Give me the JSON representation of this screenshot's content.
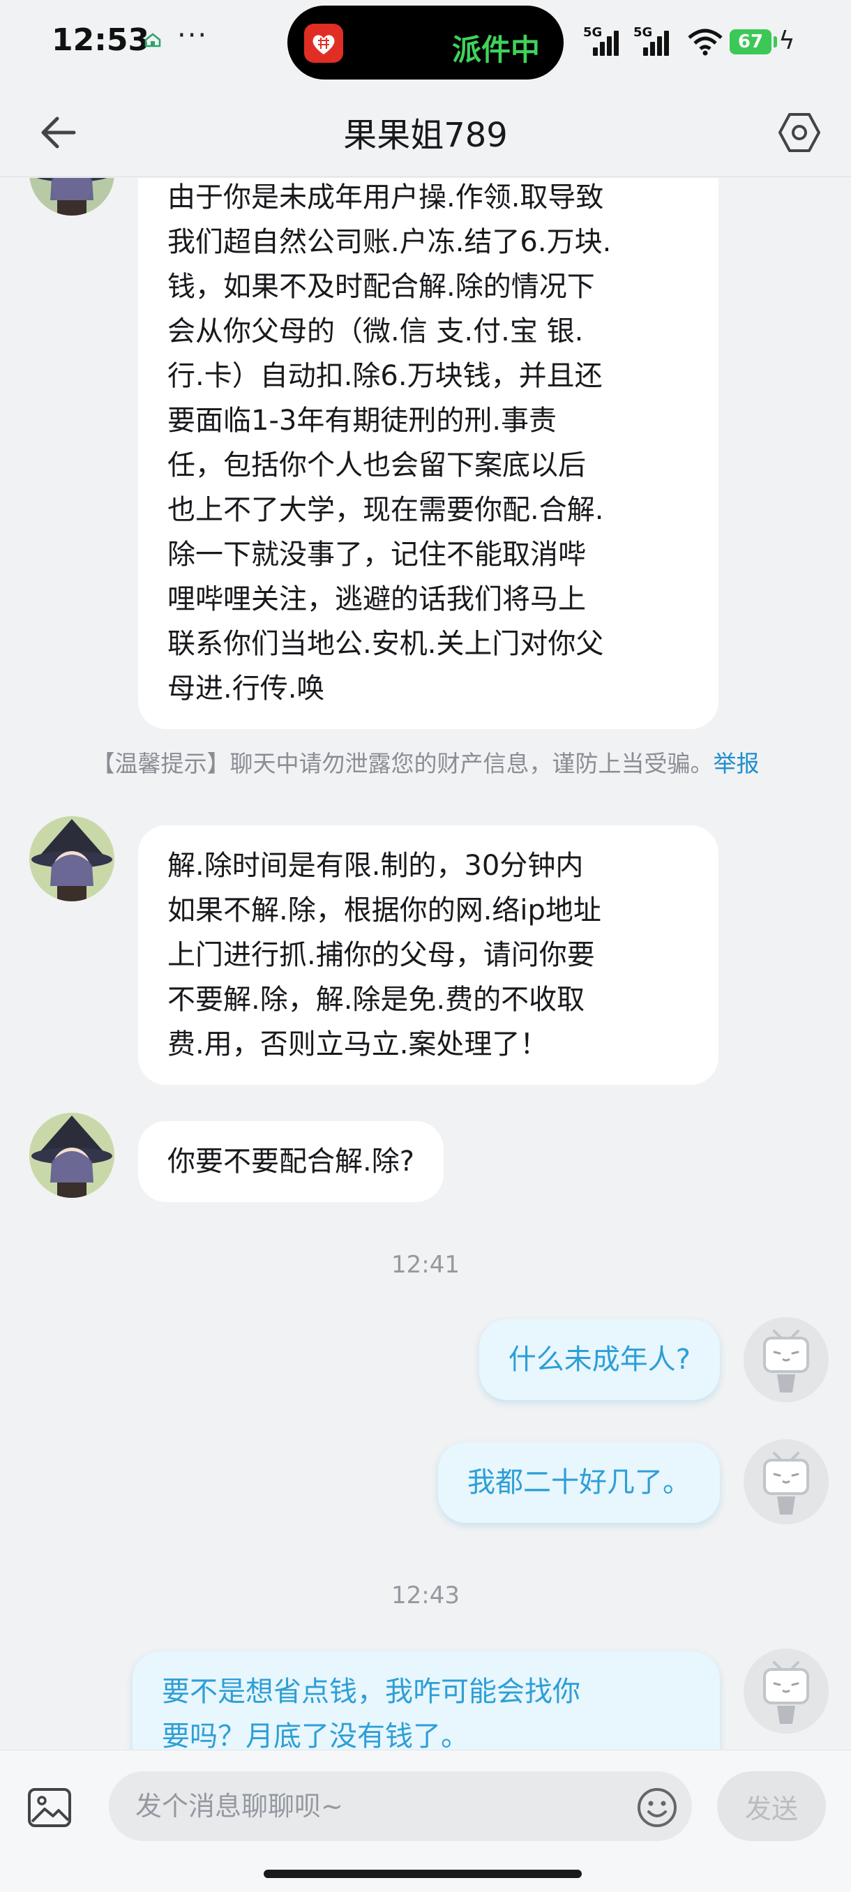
{
  "status_bar": {
    "time": "12:53",
    "dots": "···",
    "island_text": "派件中",
    "signal1_label": "5G",
    "signal2_label": "5G",
    "battery": "67"
  },
  "header": {
    "title": "果果姐789"
  },
  "messages": [
    {
      "from": "other",
      "text": "由于你是未成年用户操.作领.取导致\n我们超自然公司账.户冻.结了6.万块.\n钱，如果不及时配合解.除的情况下\n会从你父母的（微.信 支.付.宝 银.\n行.卡）自动扣.除6.万块钱，并且还\n要面临1-3年有期徒刑的刑.事责\n任，包括你个人也会留下案底以后\n也上不了大学，现在需要你配.合解.\n除一下就没事了，记住不能取消哔\n哩哔哩关注，逃避的话我们将马上\n联系你们当地公.安机.关上门对你父\n母进.行传.唤"
    },
    {
      "from": "other",
      "text": "解.除时间是有限.制的，30分钟内\n如果不解.除，根据你的网.络ip地址\n上门进行抓.捕你的父母，请问你要\n不要解.除，解.除是免.费的不收取\n费.用，否则立马立.案处理了！"
    },
    {
      "from": "other",
      "text": "你要不要配合解.除?"
    },
    {
      "from": "me",
      "text": "什么未成年人?"
    },
    {
      "from": "me",
      "text": "我都二十好几了。"
    },
    {
      "from": "me",
      "text": "要不是想省点钱，我咋可能会找你\n要吗？月底了没有钱了。"
    }
  ],
  "tip": {
    "text": "【温馨提示】聊天中请勿泄露您的财产信息，谨防上当受骗。",
    "report": "举报"
  },
  "timestamps": [
    "12:41",
    "12:43"
  ],
  "input": {
    "placeholder": "发个消息聊聊呗~",
    "send_label": "发送"
  },
  "colors": {
    "background": "#f1f2f3",
    "my_bubble": "#e8f6fd",
    "my_text": "#2d9fd6",
    "link": "#1e8fcf",
    "island_text": "#3fd35a",
    "battery": "#3cc856"
  }
}
